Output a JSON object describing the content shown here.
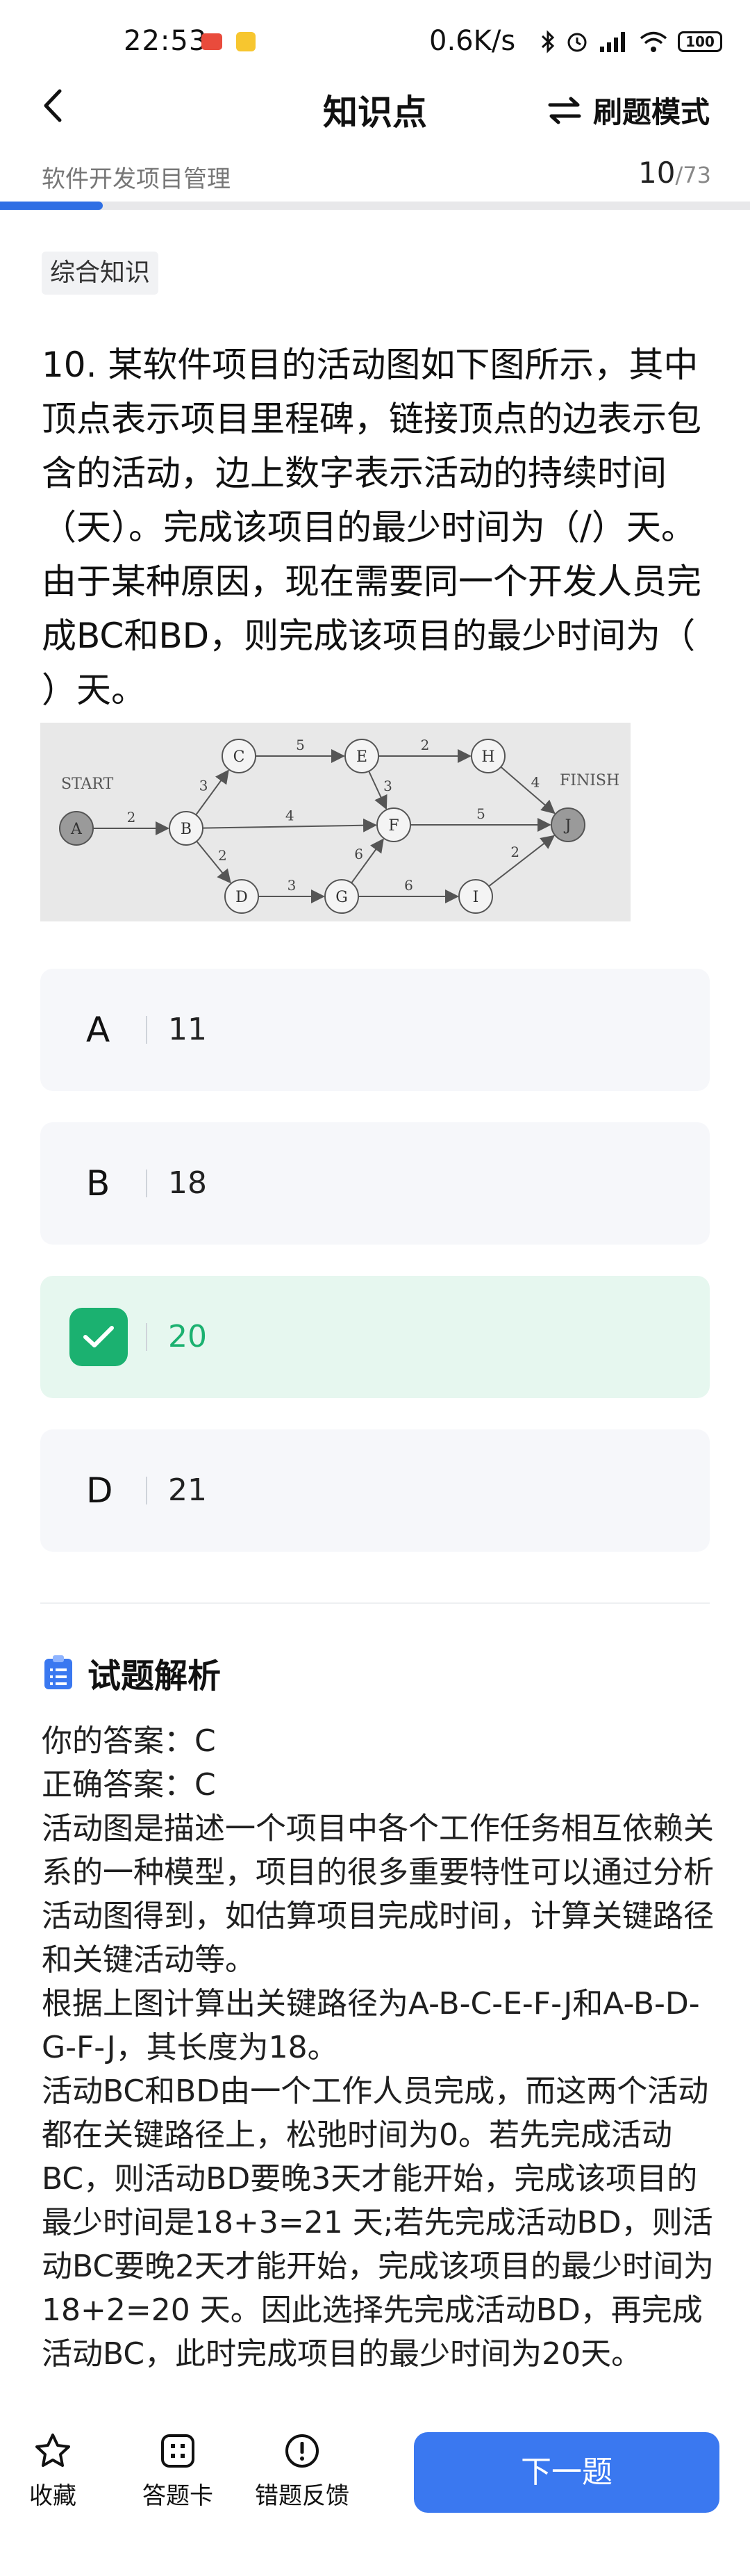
{
  "status_bar": {
    "time": "22:53",
    "network_speed": "0.6K/s",
    "battery": "100"
  },
  "nav": {
    "title": "知识点",
    "mode_label": "刷题模式"
  },
  "progress": {
    "subject": "软件开发项目管理",
    "current": "10",
    "total": "/73",
    "fraction": 0.137
  },
  "tag": "综合知识",
  "question": {
    "text": "10. 某软件项目的活动图如下图所示，其中顶点表示项目里程碑，链接顶点的边表示包含的活动，边上数字表示活动的持续时间（天）。完成该项目的最少时间为（/）天。由于某种原因，现在需要同一个开发人员完成BC和BD，则完成该项目的最少时间为（ ）天。"
  },
  "diagram": {
    "start_label": "START",
    "finish_label": "FINISH",
    "nodes": [
      "A",
      "B",
      "C",
      "D",
      "E",
      "F",
      "G",
      "H",
      "I",
      "J"
    ],
    "edges": [
      {
        "from": "A",
        "to": "B",
        "weight": "2"
      },
      {
        "from": "B",
        "to": "C",
        "weight": "3"
      },
      {
        "from": "B",
        "to": "F",
        "weight": "4"
      },
      {
        "from": "B",
        "to": "D",
        "weight": "2"
      },
      {
        "from": "C",
        "to": "E",
        "weight": "5"
      },
      {
        "from": "E",
        "to": "H",
        "weight": "2"
      },
      {
        "from": "E",
        "to": "F",
        "weight": "3"
      },
      {
        "from": "H",
        "to": "J",
        "weight": "4"
      },
      {
        "from": "F",
        "to": "J",
        "weight": "5"
      },
      {
        "from": "D",
        "to": "G",
        "weight": "3"
      },
      {
        "from": "G",
        "to": "F",
        "weight": "6"
      },
      {
        "from": "G",
        "to": "I",
        "weight": "6"
      },
      {
        "from": "I",
        "to": "J",
        "weight": "2"
      }
    ]
  },
  "options": [
    {
      "letter": "A",
      "value": "11",
      "selected": false
    },
    {
      "letter": "B",
      "value": "18",
      "selected": false
    },
    {
      "letter": "C",
      "value": "20",
      "selected": true
    },
    {
      "letter": "D",
      "value": "21",
      "selected": false
    }
  ],
  "analysis": {
    "title": "试题解析",
    "your_answer": "你的答案：C",
    "correct_answer": "正确答案：C",
    "paragraphs": [
      "活动图是描述一个项目中各个工作任务相互依赖关系的一种模型，项目的很多重要特性可以通过分析活动图得到，如估算项目完成时间，计算关键路径和关键活动等。",
      "根据上图计算出关键路径为A-B-C-E-F-J和A-B-D-G-F-J，其长度为18。",
      "活动BC和BD由一个工作人员完成，而这两个活动都在关键路径上，松弛时间为0。若先完成活动BC，则活动BD要晚3天才能开始，完成该项目的最少时间是18+3=21 天;若先完成活动BD，则活动BC要晚2天才能开始，完成该项目的最少时间为18+2=20 天。因此选择先完成活动BD，再完成活动BC，此时完成项目的最少时间为20天。"
    ]
  },
  "bottom": {
    "favorite": "收藏",
    "answer_card": "答题卡",
    "feedback": "错题反馈",
    "next": "下一题"
  },
  "colors": {
    "accent": "#3a78f0",
    "correct": "#1bb170",
    "progress": "#2f6fe4"
  }
}
